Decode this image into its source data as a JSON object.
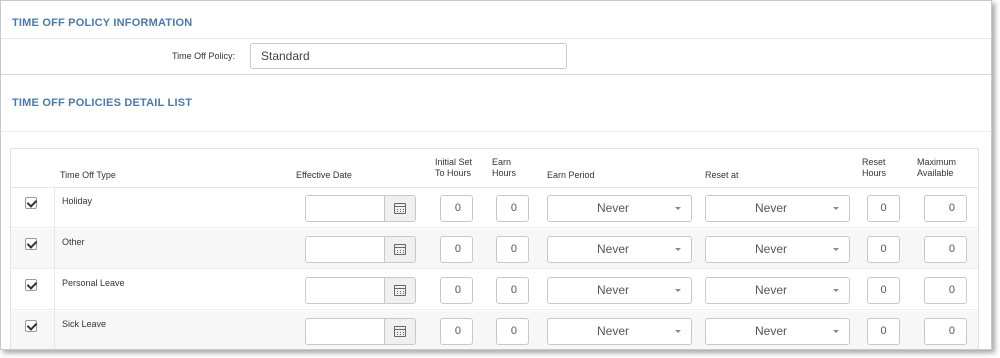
{
  "policy_info": {
    "title": "TIME OFF POLICY INFORMATION",
    "policy_label": "Time Off Policy:",
    "policy_value": "Standard"
  },
  "detail_list": {
    "title": "TIME OFF POLICIES DETAIL LIST"
  },
  "table": {
    "headers": {
      "time_off_type": "Time Off Type",
      "effective_date": "Effective Date",
      "initial_set_line1": "Initial Set",
      "initial_set_line2": "To Hours",
      "earn_hours_line1": "Earn",
      "earn_hours_line2": "Hours",
      "earn_period": "Earn Period",
      "reset_at": "Reset at",
      "reset_hours_line1": "Reset",
      "reset_hours_line2": "Hours",
      "max_available_line1": "Maximum",
      "max_available_line2": "Available"
    },
    "rows": [
      {
        "checked": true,
        "type": "Holiday",
        "effective_date": "",
        "initial_set": "0",
        "earn_hours": "0",
        "earn_period": "Never",
        "reset_at": "Never",
        "reset_hours": "0",
        "max_available": "0"
      },
      {
        "checked": true,
        "type": "Other",
        "effective_date": "",
        "initial_set": "0",
        "earn_hours": "0",
        "earn_period": "Never",
        "reset_at": "Never",
        "reset_hours": "0",
        "max_available": "0"
      },
      {
        "checked": true,
        "type": "Personal Leave",
        "effective_date": "",
        "initial_set": "0",
        "earn_hours": "0",
        "earn_period": "Never",
        "reset_at": "Never",
        "reset_hours": "0",
        "max_available": "0"
      },
      {
        "checked": true,
        "type": "Sick Leave",
        "effective_date": "",
        "initial_set": "0",
        "earn_hours": "0",
        "earn_period": "Never",
        "reset_at": "Never",
        "reset_hours": "0",
        "max_available": "0"
      }
    ]
  },
  "icons": {
    "calendar": "calendar-icon",
    "dropdown": "chevron-down-icon",
    "check": "checkbox-checked-icon"
  },
  "colors": {
    "section_title": "#4a7aad",
    "alt_row": "#f7f7f7"
  }
}
